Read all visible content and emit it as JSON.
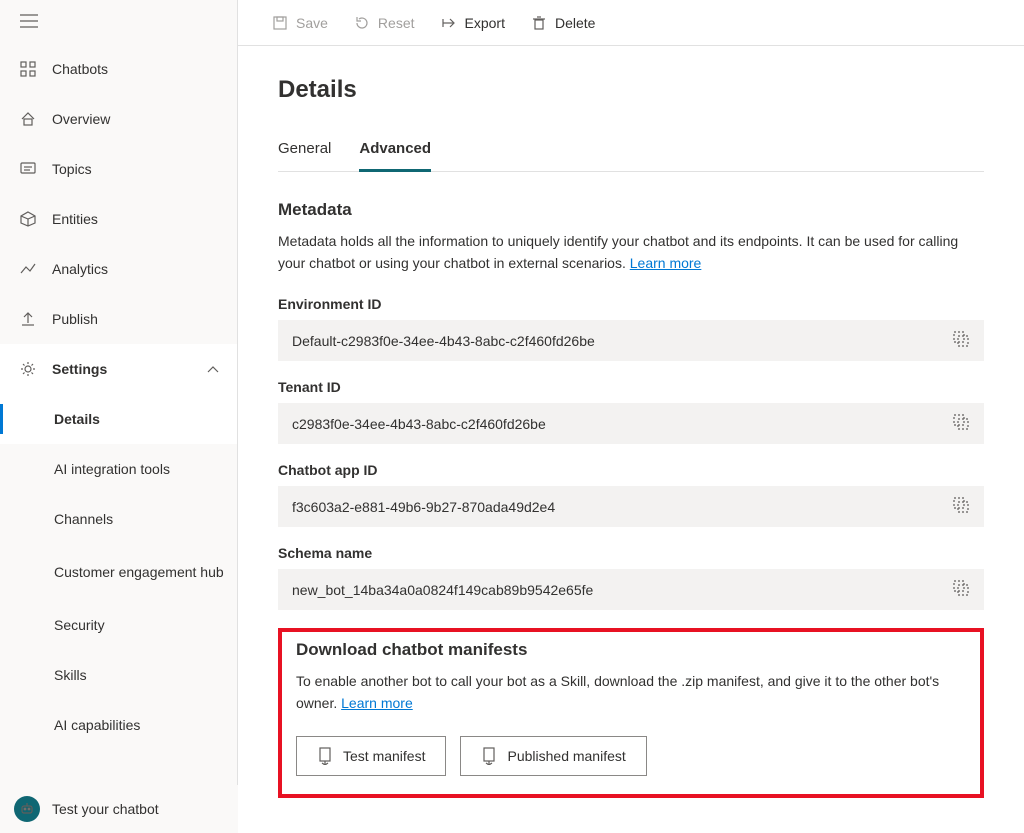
{
  "toolbar": {
    "save": "Save",
    "reset": "Reset",
    "export": "Export",
    "delete": "Delete"
  },
  "sidebar": {
    "items": {
      "chatbots": "Chatbots",
      "overview": "Overview",
      "topics": "Topics",
      "entities": "Entities",
      "analytics": "Analytics",
      "publish": "Publish",
      "settings": "Settings"
    },
    "settings_children": {
      "details": "Details",
      "ai_integration": "AI integration tools",
      "channels": "Channels",
      "engagement_hub": "Customer engagement hub",
      "security": "Security",
      "skills": "Skills",
      "ai_capabilities": "AI capabilities"
    },
    "test_chatbot": "Test your chatbot"
  },
  "page": {
    "title": "Details",
    "tabs": {
      "general": "General",
      "advanced": "Advanced"
    }
  },
  "metadata": {
    "title": "Metadata",
    "desc": "Metadata holds all the information to uniquely identify your chatbot and its endpoints. It can be used for calling your chatbot or using your chatbot in external scenarios. ",
    "learn_more": "Learn more",
    "fields": {
      "env_label": "Environment ID",
      "env_value": "Default-c2983f0e-34ee-4b43-8abc-c2f460fd26be",
      "tenant_label": "Tenant ID",
      "tenant_value": "c2983f0e-34ee-4b43-8abc-c2f460fd26be",
      "app_label": "Chatbot app ID",
      "app_value": "f3c603a2-e881-49b6-9b27-870ada49d2e4",
      "schema_label": "Schema name",
      "schema_value": "new_bot_14ba34a0a0824f149cab89b9542e65fe"
    }
  },
  "manifests": {
    "title": "Download chatbot manifests",
    "desc": "To enable another bot to call your bot as a Skill, download the .zip manifest, and give it to the other bot's owner. ",
    "learn_more": "Learn more",
    "test_btn": "Test manifest",
    "published_btn": "Published manifest"
  }
}
